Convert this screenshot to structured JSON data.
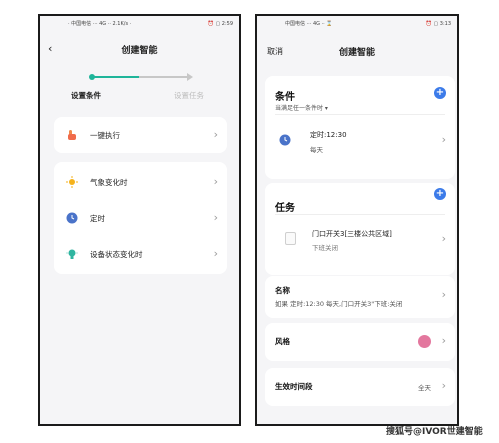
{
  "left": {
    "status_left": "· 中国电信 ··· 4G ·· 2.1K/s ·",
    "status_right": "⏰ ▢ 2:59",
    "title": "创建智能",
    "steps": [
      "设置条件",
      "设置任务"
    ],
    "items": [
      {
        "label": "一键执行"
      },
      {
        "label": "气象变化时"
      },
      {
        "label": "定时"
      },
      {
        "label": "设备状态变化时"
      }
    ]
  },
  "right": {
    "status_left": "中国电信 ··· 4G ·· ⌛",
    "status_right": "⏰ ▢ 3:13",
    "cancel": "取消",
    "title": "创建智能",
    "conditions_title": "条件",
    "conditions_sub": "当满足任一条件时 ▾",
    "condition_time": "定时:12:30",
    "condition_repeat": "每天",
    "tasks_title": "任务",
    "task_device": "门口开关3[三楼公共区域]",
    "task_action": "下班关闭",
    "name_label": "名称",
    "name_value": "如果 定时:12:30 每天,门口开关3\"下班:关闭",
    "style_label": "风格",
    "style_color": "#e3779e",
    "period_label": "生效时间段",
    "period_value": "全天"
  },
  "watermark": "搜狐号@IVOR世建智能"
}
